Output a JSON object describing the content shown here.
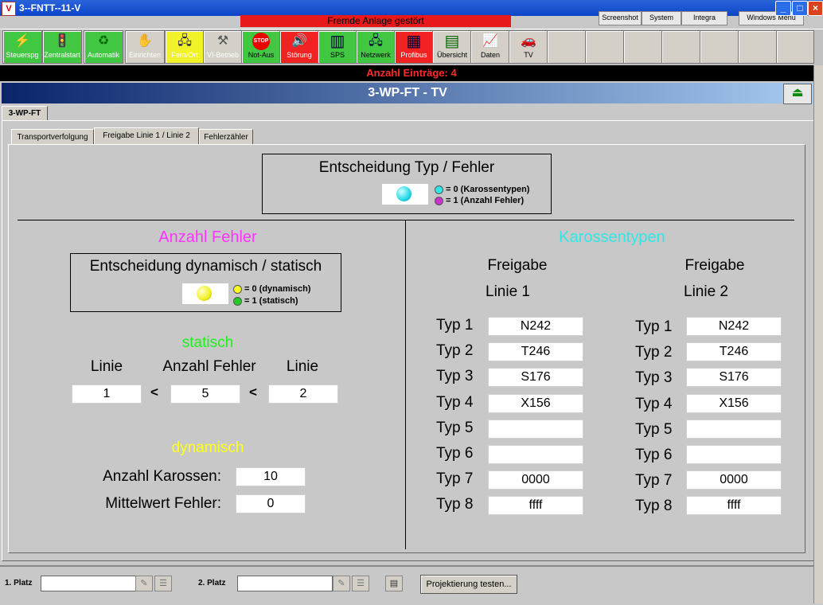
{
  "window": {
    "title": "3--FNTT--11-V",
    "alarm": "Fremde Anlage gestört",
    "menu": [
      "Screenshot",
      "System",
      "Integra",
      "Windows Menü"
    ],
    "minimize": "_",
    "maximize": "□",
    "close": "×"
  },
  "toolbar": [
    {
      "label": "Steuerspg",
      "icon": "lightning-icon",
      "glyph": "⚡"
    },
    {
      "label": "Zentralstart",
      "icon": "traffic-light-icon",
      "glyph": "🚦"
    },
    {
      "label": "Automatik",
      "icon": "recycle-icon",
      "glyph": "♻"
    },
    {
      "label": "Einrichten",
      "icon": "hand-icon",
      "glyph": "✋"
    },
    {
      "label": "Fern/Ort",
      "icon": "remote-icon",
      "glyph": "🖧"
    },
    {
      "label": "VI-Betrieb",
      "icon": "tools-icon",
      "glyph": "⚒"
    },
    {
      "label": "Not-Aus",
      "icon": "stop-icon",
      "glyph": "STOP"
    },
    {
      "label": "Störung",
      "icon": "speaker-icon",
      "glyph": "🔊"
    },
    {
      "label": "SPS",
      "icon": "plc-icon",
      "glyph": "▥"
    },
    {
      "label": "Netzwerk",
      "icon": "network-icon",
      "glyph": "🖧"
    },
    {
      "label": "Profibus",
      "icon": "profibus-icon",
      "glyph": "▦"
    },
    {
      "label": "Übersicht",
      "icon": "overview-icon",
      "glyph": "▤"
    },
    {
      "label": "Daten",
      "icon": "chart-icon",
      "glyph": "📈"
    },
    {
      "label": "TV",
      "icon": "car-icon",
      "glyph": "🚗"
    }
  ],
  "count_bar": "Anzahl Einträge: 4",
  "header_title": "3-WP-FT - TV",
  "home_glyph": "⏏",
  "outer_tab": "3-WP-FT",
  "inner_tabs": [
    "Transportverfolgung",
    "Freigabe Linie 1 / Linie 2",
    "Fehlerzähler"
  ],
  "decision": {
    "title": "Entscheidung Typ / Fehler",
    "legend0": "= 0 (Karossentypen)",
    "legend1": "= 1 (Anzahl Fehler)"
  },
  "left": {
    "title": "Anzahl Fehler",
    "decision_title": "Entscheidung dynamisch / statisch",
    "legend0": "= 0 (dynamisch)",
    "legend1": "= 1 (statisch)",
    "statisch_title": "statisch",
    "col_linie_a": "Linie",
    "col_anzahl": "Anzahl Fehler",
    "col_linie_b": "Linie",
    "linie_a_value": "1",
    "anzahl_value": "5",
    "linie_b_value": "2",
    "lt": "<",
    "dyn_title": "dynamisch",
    "karossen_label": "Anzahl Karossen:",
    "karossen_value": "10",
    "mittelwert_label": "Mittelwert Fehler:",
    "mittelwert_value": "0"
  },
  "right": {
    "title": "Karossentypen",
    "freigabe": "Freigabe",
    "linie1": "Linie 1",
    "linie2": "Linie 2",
    "rows": [
      {
        "label": "Typ 1",
        "l1": "N242",
        "l2": "N242"
      },
      {
        "label": "Typ 2",
        "l1": "T246",
        "l2": "T246"
      },
      {
        "label": "Typ 3",
        "l1": "S176",
        "l2": "S176"
      },
      {
        "label": "Typ 4",
        "l1": "X156",
        "l2": "X156"
      },
      {
        "label": "Typ 5",
        "l1": "",
        "l2": ""
      },
      {
        "label": "Typ 6",
        "l1": "",
        "l2": ""
      },
      {
        "label": "Typ 7",
        "l1": "0000",
        "l2": "0000"
      },
      {
        "label": "Typ 8",
        "l1": "ffff",
        "l2": "ffff"
      }
    ]
  },
  "status": {
    "platz1": "1. Platz",
    "platz2": "2. Platz",
    "projekt_button": "Projektierung testen..."
  },
  "colors": {
    "magenta": "#ff33ff",
    "cyan": "#33e6e6",
    "green": "#22ee22",
    "yellow": "#ffff22",
    "alarm_red": "#e8191a"
  }
}
